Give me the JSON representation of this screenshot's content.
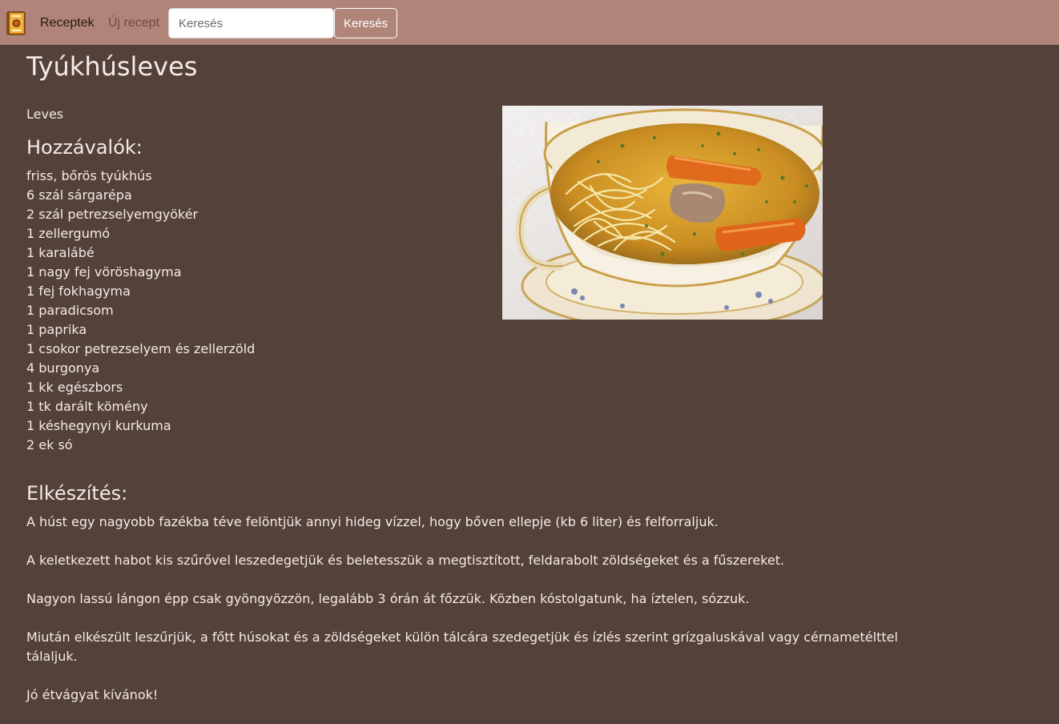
{
  "navbar": {
    "recipes_label": "Receptek",
    "new_recipe_label": "Új recept",
    "search_placeholder": "Keresés",
    "search_value": "",
    "search_button_label": "Keresés",
    "logo_icon": "cookbook-icon",
    "background_color": "#b08478"
  },
  "recipe": {
    "title": "Tyúkhúsleves",
    "category": "Leves",
    "ingredients_heading": "Hozzávalók:",
    "ingredients": [
      "friss, bőrös tyúkhús",
      "6 szál sárgarépa",
      "2 szál petrezselyemgyökér",
      "1 zellergumó",
      "1 karalábé",
      "1 nagy fej vöröshagyma",
      "1 fej fokhagyma",
      "1 paradicsom",
      "1 paprika",
      "1 csokor petrezselyem és zellerzöld",
      "4 burgonya",
      "1 kk egészbors",
      "1 tk darált kömény",
      "1 késhegynyi kurkuma",
      "2 ek só"
    ],
    "preparation_heading": "Elkészítés:",
    "preparation": [
      " A húst egy nagyobb fazékba téve felöntjük annyi hideg vízzel, hogy bőven ellepje (kb 6 liter) és felforraljuk.",
      "A keletkezett habot kis szűrővel leszedegetjük és beletesszük a megtisztított, feldarabolt zöldségeket és a fűszereket.",
      "Nagyon lassú lángon épp csak gyöngyözzön, legalább 3 órán át főzzük. Közben kóstolgatunk, ha íztelen, sózzuk.",
      "Miután elkészült leszűrjük, a főtt húsokat és a zöldségeket külön tálcára szedegetjük és ízlés szerint grízgaluskával vagy cérnametélttel tálaljuk.",
      "Jó étvágyat kívánok!"
    ],
    "background_color": "#544139",
    "text_color": "#f3ece6"
  }
}
